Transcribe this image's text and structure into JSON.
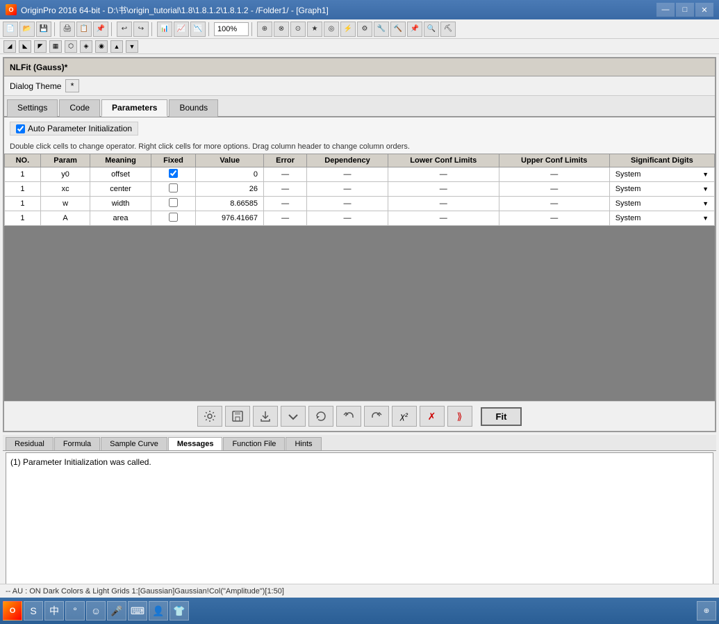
{
  "titleBar": {
    "title": "OriginPro 2016 64-bit - D:\\书\\origin_tutorial\\1.8\\1.8.1.2\\1.8.1.2 - /Folder1/ - [Graph1]",
    "appIcon": "O",
    "minimizeLabel": "—",
    "maximizeLabel": "□",
    "closeLabel": "✕"
  },
  "zoom": "100%",
  "dialogHeader": "NLFit (Gauss)*",
  "dialogTheme": {
    "label": "Dialog Theme",
    "asterisk": "*"
  },
  "tabs": [
    {
      "id": "settings",
      "label": "Settings"
    },
    {
      "id": "code",
      "label": "Code"
    },
    {
      "id": "parameters",
      "label": "Parameters",
      "active": true
    },
    {
      "id": "bounds",
      "label": "Bounds"
    }
  ],
  "autoParam": {
    "label": "Auto Parameter Initialization",
    "checked": true
  },
  "instruction": "Double click cells to change operator. Right click cells for more options. Drag column header to change column orders.",
  "tableHeaders": [
    "NO.",
    "Param",
    "Meaning",
    "Fixed",
    "Value",
    "Error",
    "Dependency",
    "Lower Conf Limits",
    "Upper Conf Limits",
    "Significant Digits"
  ],
  "tableRows": [
    {
      "no": "1",
      "param": "y0",
      "meaning": "offset",
      "fixed": true,
      "value": "0",
      "error": "—",
      "dependency": "—",
      "lower": "—",
      "upper": "—",
      "sigDigits": "System"
    },
    {
      "no": "1",
      "param": "xc",
      "meaning": "center",
      "fixed": false,
      "value": "26",
      "error": "—",
      "dependency": "—",
      "lower": "—",
      "upper": "—",
      "sigDigits": "System"
    },
    {
      "no": "1",
      "param": "w",
      "meaning": "width",
      "fixed": false,
      "value": "8.66585",
      "error": "—",
      "dependency": "—",
      "lower": "—",
      "upper": "—",
      "sigDigits": "System"
    },
    {
      "no": "1",
      "param": "A",
      "meaning": "area",
      "fixed": false,
      "value": "976.41667",
      "error": "—",
      "dependency": "—",
      "lower": "—",
      "upper": "—",
      "sigDigits": "System"
    }
  ],
  "toolbarIcons": [
    "⚙",
    "💾",
    "📂",
    "↓",
    "↺",
    "↻",
    "χ²",
    "✗",
    "⟫"
  ],
  "fitButton": "Fit",
  "bottomTabs": [
    {
      "id": "residual",
      "label": "Residual"
    },
    {
      "id": "formula",
      "label": "Formula"
    },
    {
      "id": "sampleCurve",
      "label": "Sample Curve"
    },
    {
      "id": "messages",
      "label": "Messages",
      "active": true
    },
    {
      "id": "functionFile",
      "label": "Function File"
    },
    {
      "id": "hints",
      "label": "Hints"
    }
  ],
  "messagesContent": "(1) Parameter Initialization was called.",
  "statusBar": "--   AU : ON  Dark Colors & Light Grids  1:[Gaussian]Gaussian!Col(\"Amplitude\")[1:50]"
}
